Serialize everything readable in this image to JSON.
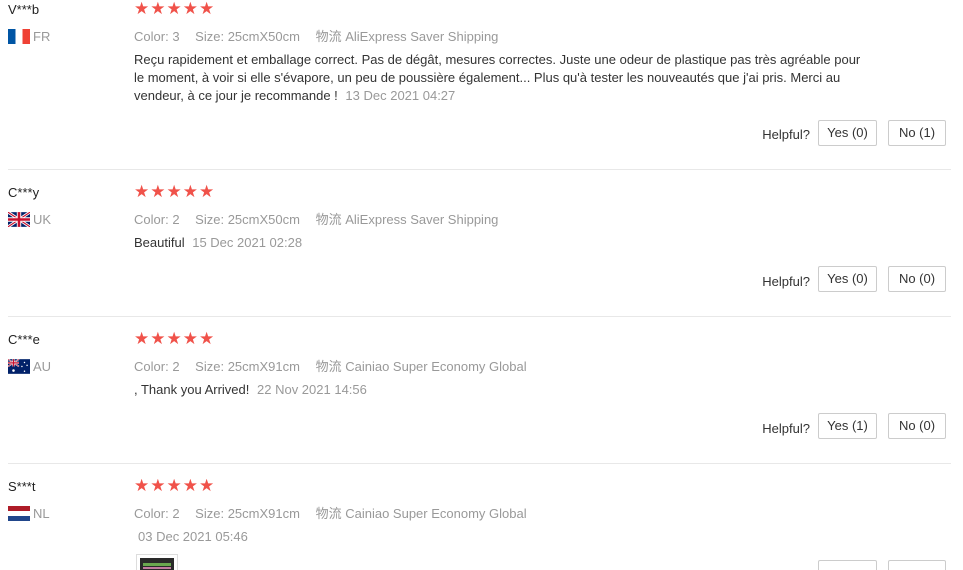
{
  "helpful_label": "Helpful?",
  "meta_labels": {
    "color": "Color:",
    "size": "Size:",
    "shipping": "物流"
  },
  "rating_stars": "★★★★★",
  "colors": {
    "star": "#f0524a",
    "muted": "#999999",
    "text": "#333333",
    "divider": "#e8e8e8"
  },
  "reviews": [
    {
      "user": "V***b",
      "country": "FR",
      "flag": "fr-flag",
      "color": "3",
      "size": "25cmX50cm",
      "shipping": "AliExpress Saver Shipping",
      "text": "Reçu rapidement et emballage correct. Pas de dégât, mesures correctes. Juste une odeur de plastique pas très agréable pour le moment, à voir si elle s'évapore, un peu de poussière également... Plus qu'à tester les nouveautés que j'ai pris. Merci au vendeur, à ce jour je recommande !",
      "date": "13 Dec 2021 04:27",
      "yes": "Yes (0)",
      "no": "No (1)"
    },
    {
      "user": "C***y",
      "country": "UK",
      "flag": "uk-flag",
      "color": "2",
      "size": "25cmX50cm",
      "shipping": "AliExpress Saver Shipping",
      "text": "Beautiful",
      "date": "15 Dec 2021 02:28",
      "yes": "Yes (0)",
      "no": "No (0)"
    },
    {
      "user": "C***e",
      "country": "AU",
      "flag": "au-flag",
      "color": "2",
      "size": "25cmX91cm",
      "shipping": "Cainiao Super Economy Global",
      "text": ", Thank you Arrived!",
      "date": "22 Nov 2021 14:56",
      "yes": "Yes (1)",
      "no": "No (0)"
    },
    {
      "user": "S***t",
      "country": "NL",
      "flag": "nl-flag",
      "color": "2",
      "size": "25cmX91cm",
      "shipping": "Cainiao Super Economy Global",
      "text": "",
      "date": "03 Dec 2021 05:46",
      "yes": "",
      "no": ""
    }
  ]
}
